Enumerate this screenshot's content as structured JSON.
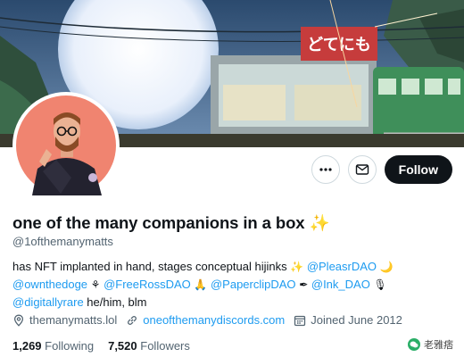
{
  "banner": {
    "shop_sign": "どてにも"
  },
  "header": {
    "more_icon": "ellipsis-icon",
    "message_icon": "envelope-icon",
    "follow_label": "Follow"
  },
  "profile": {
    "display_name": "one of the many companions in a box",
    "name_emoji": "✨",
    "handle": "@1ofthemanymatts",
    "bio": {
      "line1_text": "has NFT implanted in hand, stages conceptual hijinks",
      "line1_sparkle": "✨",
      "mention_pleasr": "@PleasrDAO",
      "moon": "🌙",
      "mention_ownthedoge": "@ownthedoge",
      "herb": "⚘",
      "mention_freeross": "@FreeRossDAO",
      "pray": "🙏",
      "mention_paperclip": "@PaperclipDAO",
      "pen": "✒",
      "mention_ink": "@Ink_DAO",
      "mic": "🎙",
      "mention_digitallyrare": "@digitallyrare",
      "tail": "he/him, blm"
    },
    "location": "themanymatts.lol",
    "website": "oneofthemanydiscords.com",
    "joined": "Joined June 2012",
    "following_count": "1,269",
    "following_label": "Following",
    "followers_count": "7,520",
    "followers_label": "Followers"
  },
  "watermark": {
    "text": "老雅痞"
  },
  "colors": {
    "accent": "#1d9bf0",
    "follow_bg": "#0f1419",
    "secondary_text": "#536471",
    "avatar_bg": "#f08470"
  }
}
